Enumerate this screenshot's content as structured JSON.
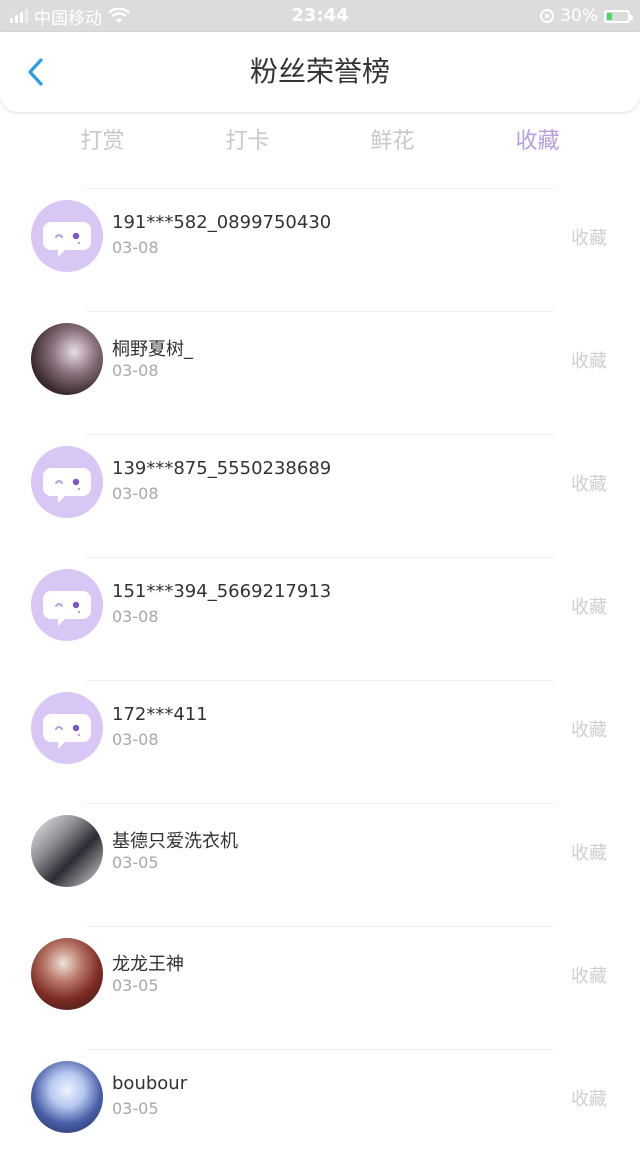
{
  "status": {
    "carrier": "中国移动",
    "time": "23:44",
    "battery": "30%",
    "battery_level": 0.3
  },
  "header": {
    "title": "粉丝荣誉榜",
    "back_icon": "chevron-left-icon"
  },
  "tabs": [
    {
      "label": "打赏",
      "active": false
    },
    {
      "label": "打卡",
      "active": false
    },
    {
      "label": "鲜花",
      "active": false
    },
    {
      "label": "收藏",
      "active": true
    }
  ],
  "colors": {
    "accent": "#b89ee0",
    "back": "#2a9be6",
    "default_avatar": "#d8c6f5"
  },
  "fans": [
    {
      "name": "191***582_0899750430",
      "date": "03-08",
      "action": "收藏",
      "avatar": "default"
    },
    {
      "name": "桐野夏树_",
      "date": "03-08",
      "action": "收藏",
      "avatar": "photo-dark"
    },
    {
      "name": "139***875_5550238689",
      "date": "03-08",
      "action": "收藏",
      "avatar": "default"
    },
    {
      "name": "151***394_5669217913",
      "date": "03-08",
      "action": "收藏",
      "avatar": "default"
    },
    {
      "name": "172***411",
      "date": "03-08",
      "action": "收藏",
      "avatar": "default"
    },
    {
      "name": "基德只爱洗衣机",
      "date": "03-05",
      "action": "收藏",
      "avatar": "photo-grey"
    },
    {
      "name": "龙龙王神",
      "date": "03-05",
      "action": "收藏",
      "avatar": "photo-red"
    },
    {
      "name": "boubour",
      "date": "03-05",
      "action": "收藏",
      "avatar": "photo-blue"
    }
  ]
}
